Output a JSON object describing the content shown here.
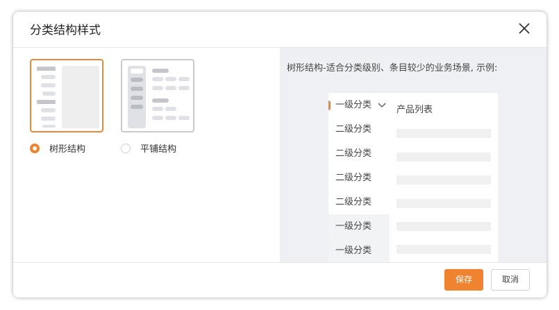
{
  "dialog": {
    "title": "分类结构样式",
    "close_icon": "close-icon"
  },
  "options": [
    {
      "label": "树形结构",
      "selected": true
    },
    {
      "label": "平铺结构",
      "selected": false
    }
  ],
  "preview": {
    "description": "树形结构-适合分类级别、条目较少的业务场景, 示例:",
    "categories": [
      {
        "label": "一级分类",
        "level": 1,
        "active": true,
        "expanded": true
      },
      {
        "label": "二级分类",
        "level": 2
      },
      {
        "label": "二级分类",
        "level": 2
      },
      {
        "label": "二级分类",
        "level": 2
      },
      {
        "label": "二级分类",
        "level": 2
      },
      {
        "label": "一级分类",
        "level": 1
      },
      {
        "label": "一级分类",
        "level": 1
      }
    ],
    "product_list_title": "产品列表",
    "accent_color": "#f0832f"
  },
  "footer": {
    "save_label": "保存",
    "cancel_label": "取消"
  }
}
